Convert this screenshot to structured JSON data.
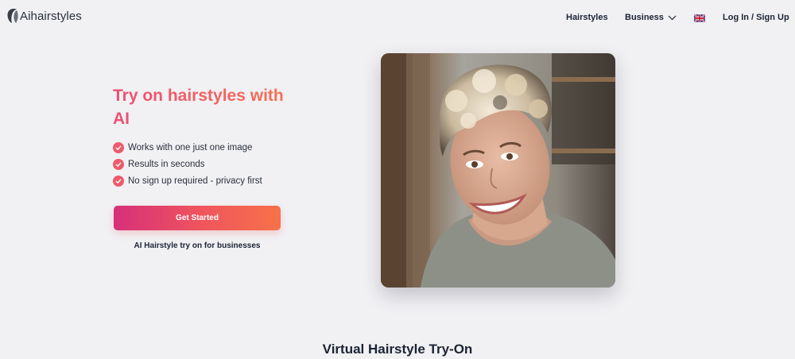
{
  "header": {
    "logo_text": "Aihairstyles",
    "nav": {
      "hairstyles": "Hairstyles",
      "business": "Business",
      "login": "Log In / Sign Up"
    },
    "language_flag_icon": "uk-flag-icon"
  },
  "hero": {
    "title": "Try on hairstyles with AI",
    "features": [
      "Works with one just one image",
      "Results in seconds",
      "No sign up required - privacy first"
    ],
    "cta_label": "Get Started",
    "business_link": "AI Hairstyle try on for businesses"
  },
  "section": {
    "title": "Virtual Hairstyle Try-On"
  },
  "colors": {
    "accent_start": "#d6307a",
    "accent_end": "#f77248",
    "check": "#ee5a6c",
    "background": "#f1f1f4",
    "text": "#1c2333"
  }
}
